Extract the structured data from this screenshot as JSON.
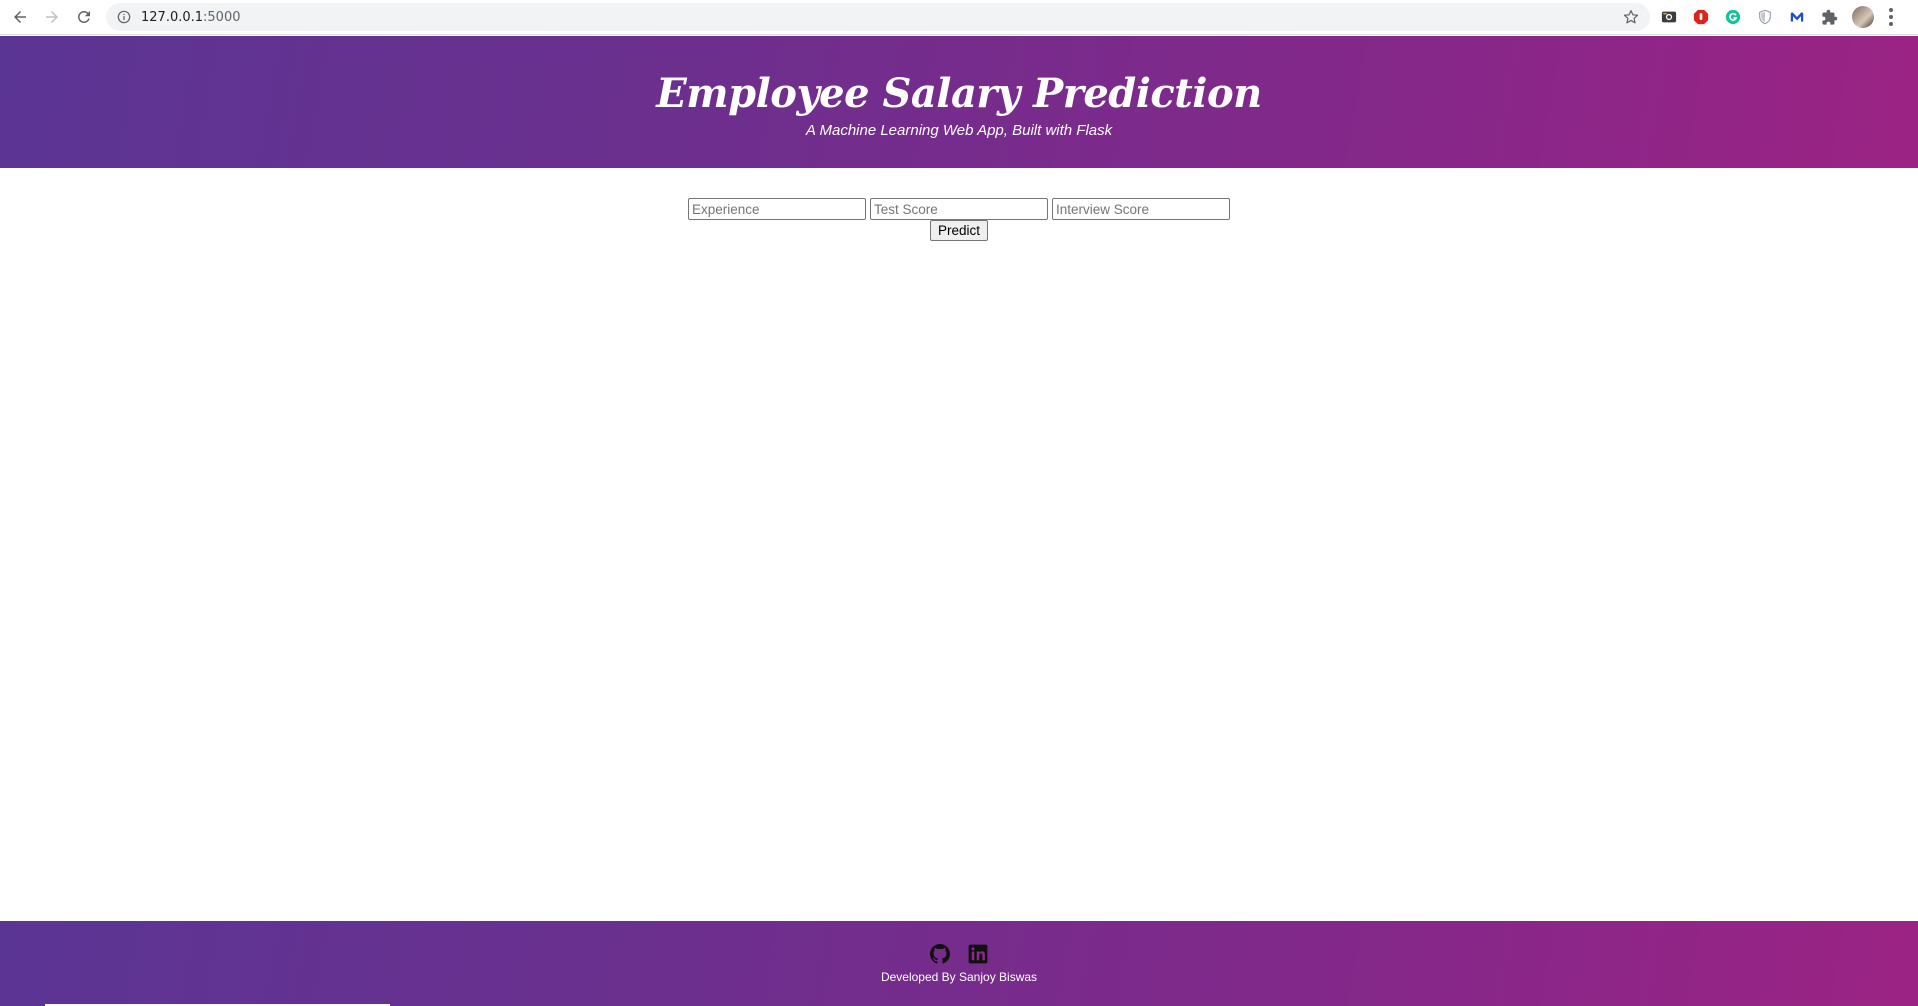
{
  "browser": {
    "url_host": "127.0.0.1",
    "url_port": ":5000"
  },
  "header": {
    "title": "Employee Salary Prediction",
    "subtitle": "A Machine Learning Web App, Built with Flask"
  },
  "form": {
    "fields": [
      {
        "placeholder": "Experience",
        "value": ""
      },
      {
        "placeholder": "Test Score",
        "value": ""
      },
      {
        "placeholder": "Interview Score",
        "value": ""
      }
    ],
    "submit_label": "Predict"
  },
  "footer": {
    "icons": [
      "github-icon",
      "linkedin-icon"
    ],
    "credit": "Developed By Sanjoy Biswas"
  },
  "colors": {
    "gradient_start": "#5b3594",
    "gradient_end": "#9b2384"
  }
}
